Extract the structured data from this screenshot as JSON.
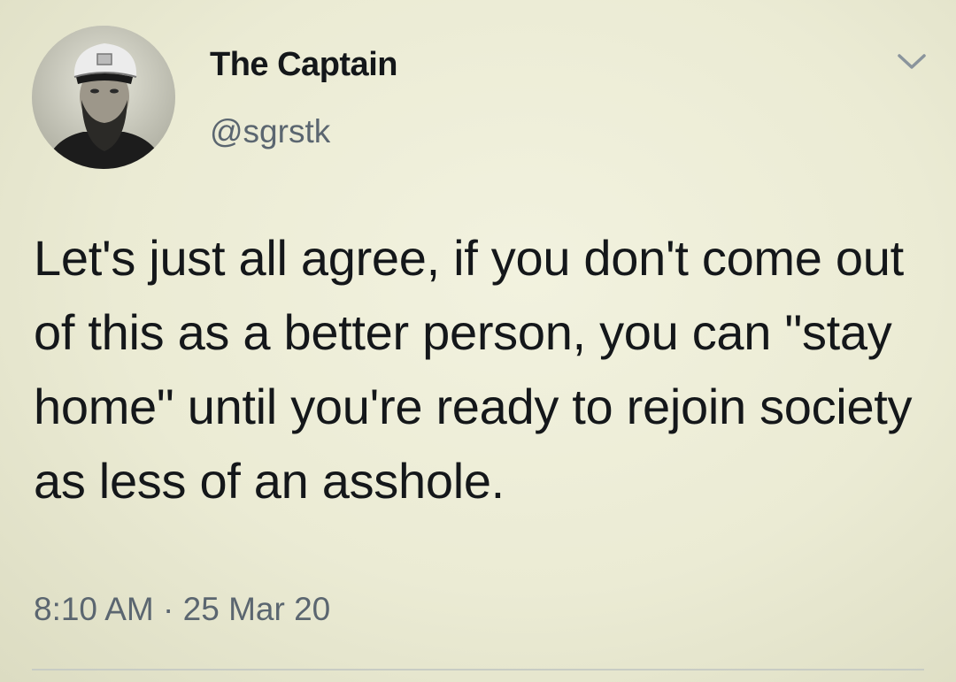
{
  "tweet": {
    "author": {
      "display_name": "The Captain",
      "handle": "@sgrstk",
      "avatar_icon": "avatar-captain-photo"
    },
    "text": "Let's just all agree, if you don't come out of this as a better person, you can \"stay home\" until you're ready to rejoin society as less of an asshole.",
    "time": "8:10 AM",
    "separator": "·",
    "date": "25 Mar 20",
    "menu_icon": "chevron-down-icon"
  },
  "colors": {
    "background": "#ebebd3",
    "primary_text": "#14171a",
    "secondary_text": "#5b6670",
    "divider": "#c8ccc4"
  }
}
